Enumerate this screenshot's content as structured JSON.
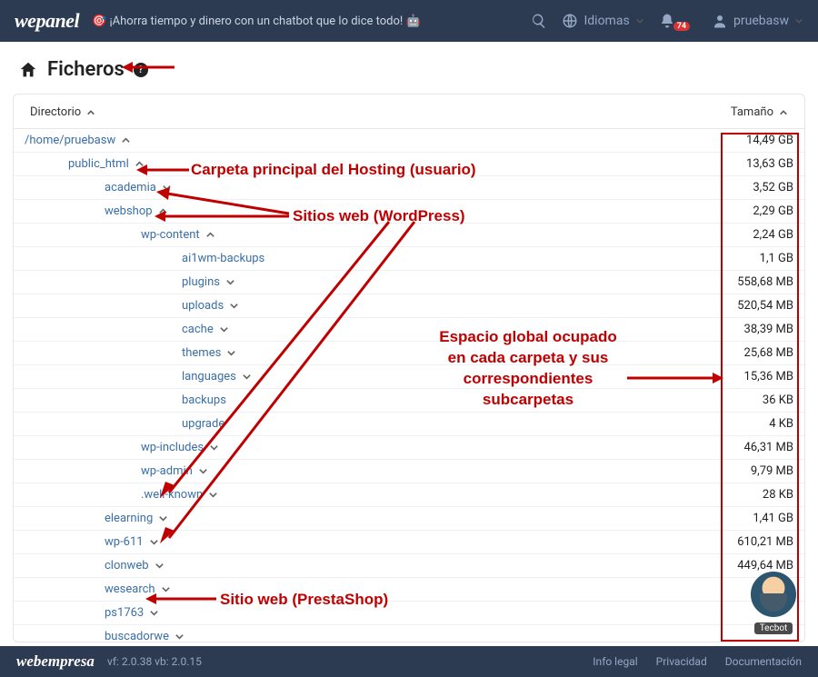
{
  "topbar": {
    "brand": "wepanel",
    "promo": "🎯 ¡Ahorra tiempo y dinero con un chatbot que lo dice todo! 🤖",
    "lang_label": "Idiomas",
    "user_label": "pruebasw",
    "notif_count": "74"
  },
  "page": {
    "title": "Ficheros"
  },
  "table": {
    "head_dir": "Directorio",
    "head_size": "Tamaño"
  },
  "rows": [
    {
      "name": "/home/pruebasw",
      "size": "14,49 GB",
      "indent": 0,
      "expanded": true,
      "hasChildren": true
    },
    {
      "name": "public_html",
      "size": "13,63 GB",
      "indent": 1,
      "expanded": true,
      "hasChildren": true
    },
    {
      "name": "academia",
      "size": "3,52 GB",
      "indent": 2,
      "expanded": false,
      "hasChildren": true
    },
    {
      "name": "webshop",
      "size": "2,29 GB",
      "indent": 2,
      "expanded": true,
      "hasChildren": true
    },
    {
      "name": "wp-content",
      "size": "2,24 GB",
      "indent": 3,
      "expanded": true,
      "hasChildren": true
    },
    {
      "name": "ai1wm-backups",
      "size": "1,1 GB",
      "indent": 4,
      "expanded": false,
      "hasChildren": false
    },
    {
      "name": "plugins",
      "size": "558,68 MB",
      "indent": 4,
      "expanded": false,
      "hasChildren": true
    },
    {
      "name": "uploads",
      "size": "520,54 MB",
      "indent": 4,
      "expanded": false,
      "hasChildren": true
    },
    {
      "name": "cache",
      "size": "38,39 MB",
      "indent": 4,
      "expanded": false,
      "hasChildren": true
    },
    {
      "name": "themes",
      "size": "25,68 MB",
      "indent": 4,
      "expanded": false,
      "hasChildren": true
    },
    {
      "name": "languages",
      "size": "15,36 MB",
      "indent": 4,
      "expanded": false,
      "hasChildren": true
    },
    {
      "name": "backups",
      "size": "36 KB",
      "indent": 4,
      "expanded": false,
      "hasChildren": false
    },
    {
      "name": "upgrade",
      "size": "4 KB",
      "indent": 4,
      "expanded": false,
      "hasChildren": false
    },
    {
      "name": "wp-includes",
      "size": "46,31 MB",
      "indent": 3,
      "expanded": false,
      "hasChildren": true
    },
    {
      "name": "wp-admin",
      "size": "9,79 MB",
      "indent": 3,
      "expanded": false,
      "hasChildren": true
    },
    {
      "name": ".well-known",
      "size": "28 KB",
      "indent": 3,
      "expanded": false,
      "hasChildren": true
    },
    {
      "name": "elearning",
      "size": "1,41 GB",
      "indent": 2,
      "expanded": false,
      "hasChildren": true
    },
    {
      "name": "wp-611",
      "size": "610,21 MB",
      "indent": 2,
      "expanded": false,
      "hasChildren": true
    },
    {
      "name": "clonweb",
      "size": "449,64 MB",
      "indent": 2,
      "expanded": false,
      "hasChildren": true
    },
    {
      "name": "wesearch",
      "size": "",
      "indent": 2,
      "expanded": false,
      "hasChildren": true
    },
    {
      "name": "ps1763",
      "size": "",
      "indent": 2,
      "expanded": false,
      "hasChildren": true
    },
    {
      "name": "buscadorwe",
      "size": "",
      "indent": 2,
      "expanded": false,
      "hasChildren": true
    }
  ],
  "footer": {
    "brand": "webempresa",
    "version": "vf: 2.0.38 vb: 2.0.15",
    "links": [
      "Info legal",
      "Privacidad",
      "Documentación"
    ]
  },
  "tecbot": {
    "label": "Tecbot"
  },
  "annotations": {
    "a1": "Carpeta principal del Hosting (usuario)",
    "a2": "Sitios web (WordPress)",
    "a3": "Espacio global ocupado en cada carpeta y sus correspondientes subcarpetas",
    "a4": "Sitio web (PrestaShop)"
  }
}
